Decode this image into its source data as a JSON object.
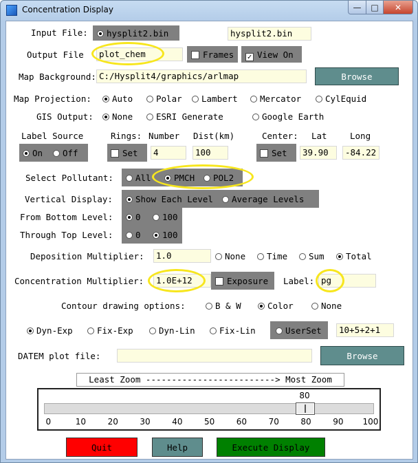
{
  "window": {
    "title": "Concentration Display",
    "min": "—",
    "max": "□",
    "close": "✕"
  },
  "input_file": {
    "label": "Input File:",
    "radio_label": "hysplit2.bin",
    "value": "hysplit2.bin"
  },
  "output_file": {
    "label": "Output File",
    "value": "plot_chem",
    "frames_label": "Frames",
    "view_label": "View On"
  },
  "map_background": {
    "label": "Map Background:",
    "value": "C:/Hysplit4/graphics/arlmap",
    "browse": "Browse"
  },
  "map_projection": {
    "label": "Map Projection:",
    "options": [
      "Auto",
      "Polar",
      "Lambert",
      "Mercator",
      "CylEquid"
    ],
    "selected": "Auto"
  },
  "gis_output": {
    "label": "GIS Output:",
    "options": [
      "None",
      "ESRI Generate",
      "Google Earth"
    ],
    "selected": "None"
  },
  "label_source": {
    "label": "Label Source",
    "on": "On",
    "off": "Off"
  },
  "rings": {
    "label": "Rings:",
    "set": "Set",
    "number_label": "Number",
    "number": "4",
    "dist_label": "Dist(km)",
    "dist": "100"
  },
  "center": {
    "label": "Center:",
    "set": "Set",
    "lat_label": "Lat",
    "lat": "39.90",
    "long_label": "Long",
    "long": "-84.22"
  },
  "pollutant": {
    "label": "Select Pollutant:",
    "options": [
      "All",
      "PMCH",
      "POL2"
    ],
    "selected": "PMCH"
  },
  "vertical": {
    "label": "Vertical Display:",
    "options": [
      "Show Each Level",
      "Average Levels"
    ],
    "selected": "Show Each Level"
  },
  "bottom_level": {
    "label": "From Bottom Level:",
    "options": [
      "0",
      "100"
    ],
    "selected": "0"
  },
  "top_level": {
    "label": "Through Top Level:",
    "options": [
      "0",
      "100"
    ],
    "selected": "100"
  },
  "deposition": {
    "label": "Deposition Multiplier:",
    "value": "1.0",
    "options": [
      "None",
      "Time",
      "Sum",
      "Total"
    ],
    "selected": "Total"
  },
  "concentration": {
    "label": "Concentration Multiplier:",
    "value": "1.0E+12",
    "exposure": "Exposure",
    "label_label": "Label:",
    "label_value": "pg"
  },
  "contour": {
    "label": "Contour drawing options:",
    "options": [
      "B & W",
      "Color",
      "None"
    ],
    "selected": "Color"
  },
  "contour_levels": {
    "options": [
      "Dyn-Exp",
      "Fix-Exp",
      "Dyn-Lin",
      "Fix-Lin",
      "UserSet"
    ],
    "selected": "Dyn-Exp",
    "value": "10+5+2+1"
  },
  "datem": {
    "label": "DATEM plot file:",
    "value": "",
    "browse": "Browse"
  },
  "zoom": {
    "caption": "Least Zoom -------------------------> Most Zoom",
    "value": 80,
    "value_label": "80",
    "ticks": [
      "0",
      "10",
      "20",
      "30",
      "40",
      "50",
      "60",
      "70",
      "80",
      "90",
      "100"
    ]
  },
  "buttons": {
    "quit": "Quit",
    "help": "Help",
    "execute": "Execute Display"
  },
  "colors": {
    "quit": "#ff0000",
    "help": "#5f8d8d",
    "execute": "#008000",
    "browse": "#5f8d8d",
    "highlight": "#f7e61e",
    "entry": "#fdfde0"
  }
}
